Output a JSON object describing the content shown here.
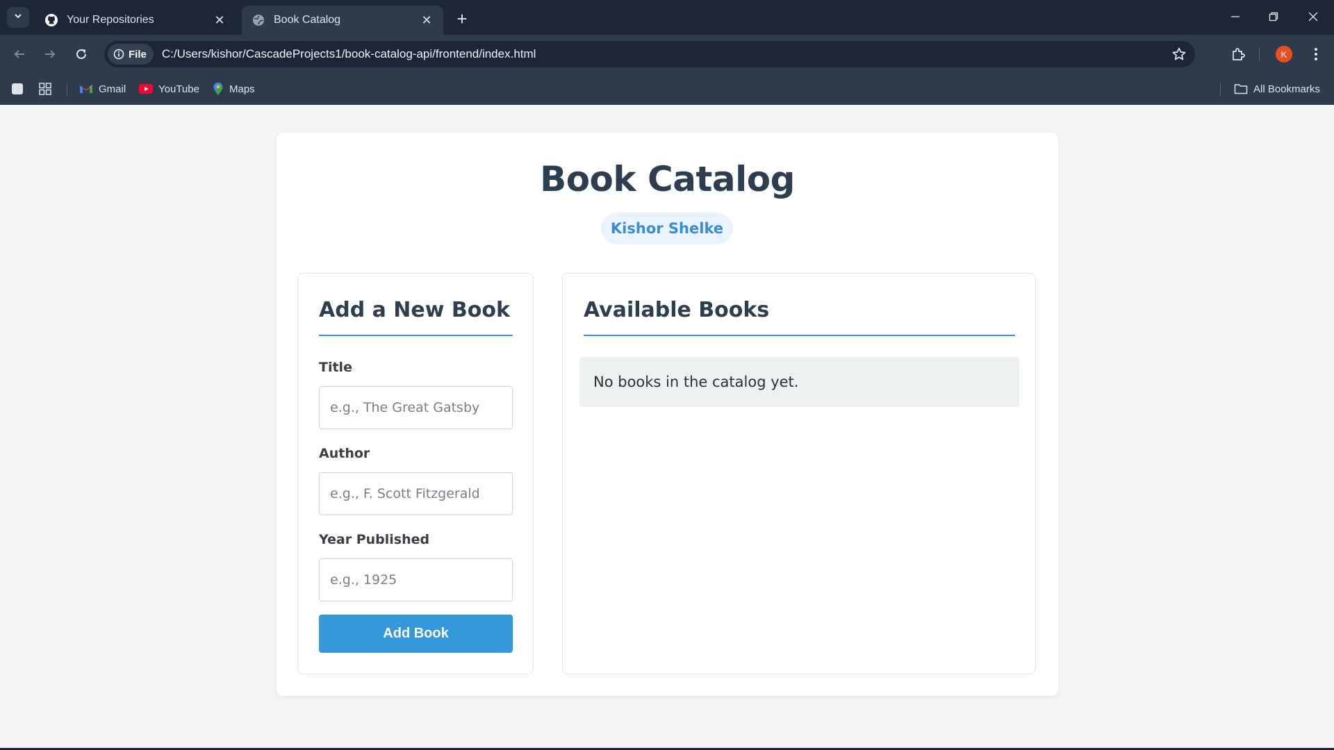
{
  "browser": {
    "tabs": [
      {
        "title": "Your Repositories",
        "favicon": "github-icon",
        "active": false
      },
      {
        "title": "Book Catalog",
        "favicon": "globe-icon",
        "active": true
      }
    ],
    "address": {
      "chip_label": "File",
      "url": "C:/Users/kishor/CascadeProjects1/book-catalog-api/frontend/index.html"
    },
    "profile_initial": "K",
    "bookmarks": [
      {
        "label": "Gmail",
        "icon": "gmail-icon"
      },
      {
        "label": "YouTube",
        "icon": "youtube-icon"
      },
      {
        "label": "Maps",
        "icon": "maps-icon"
      }
    ],
    "all_bookmarks_label": "All Bookmarks"
  },
  "app": {
    "title": "Book Catalog",
    "author": "Kishor Shelke",
    "form": {
      "heading": "Add a New Book",
      "title_label": "Title",
      "title_placeholder": "e.g., The Great Gatsby",
      "author_label": "Author",
      "author_placeholder": "e.g., F. Scott Fitzgerald",
      "year_label": "Year Published",
      "year_placeholder": "e.g., 1925",
      "submit_label": "Add Book"
    },
    "list": {
      "heading": "Available Books",
      "empty_message": "No books in the catalog yet."
    }
  },
  "colors": {
    "accent": "#3498db",
    "heading": "#2c3e50",
    "badge_bg": "#eaf3fb",
    "chrome_bg": "#1c2636"
  }
}
